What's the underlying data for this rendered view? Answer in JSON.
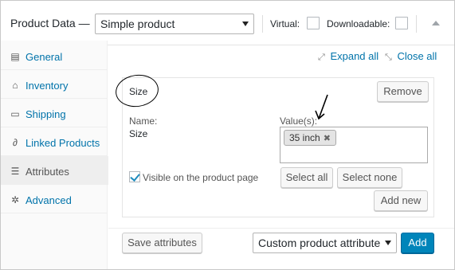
{
  "header": {
    "title": "Product Data —",
    "product_type": "Simple product",
    "virtual_label": "Virtual:",
    "downloadable_label": "Downloadable:"
  },
  "sidebar": {
    "items": [
      {
        "label": "General",
        "icon": "general-icon"
      },
      {
        "label": "Inventory",
        "icon": "inventory-icon"
      },
      {
        "label": "Shipping",
        "icon": "shipping-icon"
      },
      {
        "label": "Linked Products",
        "icon": "link-icon"
      },
      {
        "label": "Attributes",
        "icon": "attributes-icon",
        "active": true
      },
      {
        "label": "Advanced",
        "icon": "gear-icon"
      }
    ]
  },
  "panel": {
    "expand_all": "Expand all",
    "close_all": "Close all",
    "attribute": {
      "title": "Size",
      "remove_label": "Remove",
      "name_label": "Name:",
      "name_value": "Size",
      "values_label": "Value(s):",
      "values": [
        "35 inch"
      ],
      "visible_label": "Visible on the product page",
      "visible_checked": true,
      "select_all": "Select all",
      "select_none": "Select none",
      "add_new": "Add new"
    },
    "save_attributes": "Save attributes",
    "attribute_type": "Custom product attribute",
    "add_label": "Add"
  },
  "colors": {
    "link": "#0073aa",
    "primary": "#0085ba"
  }
}
